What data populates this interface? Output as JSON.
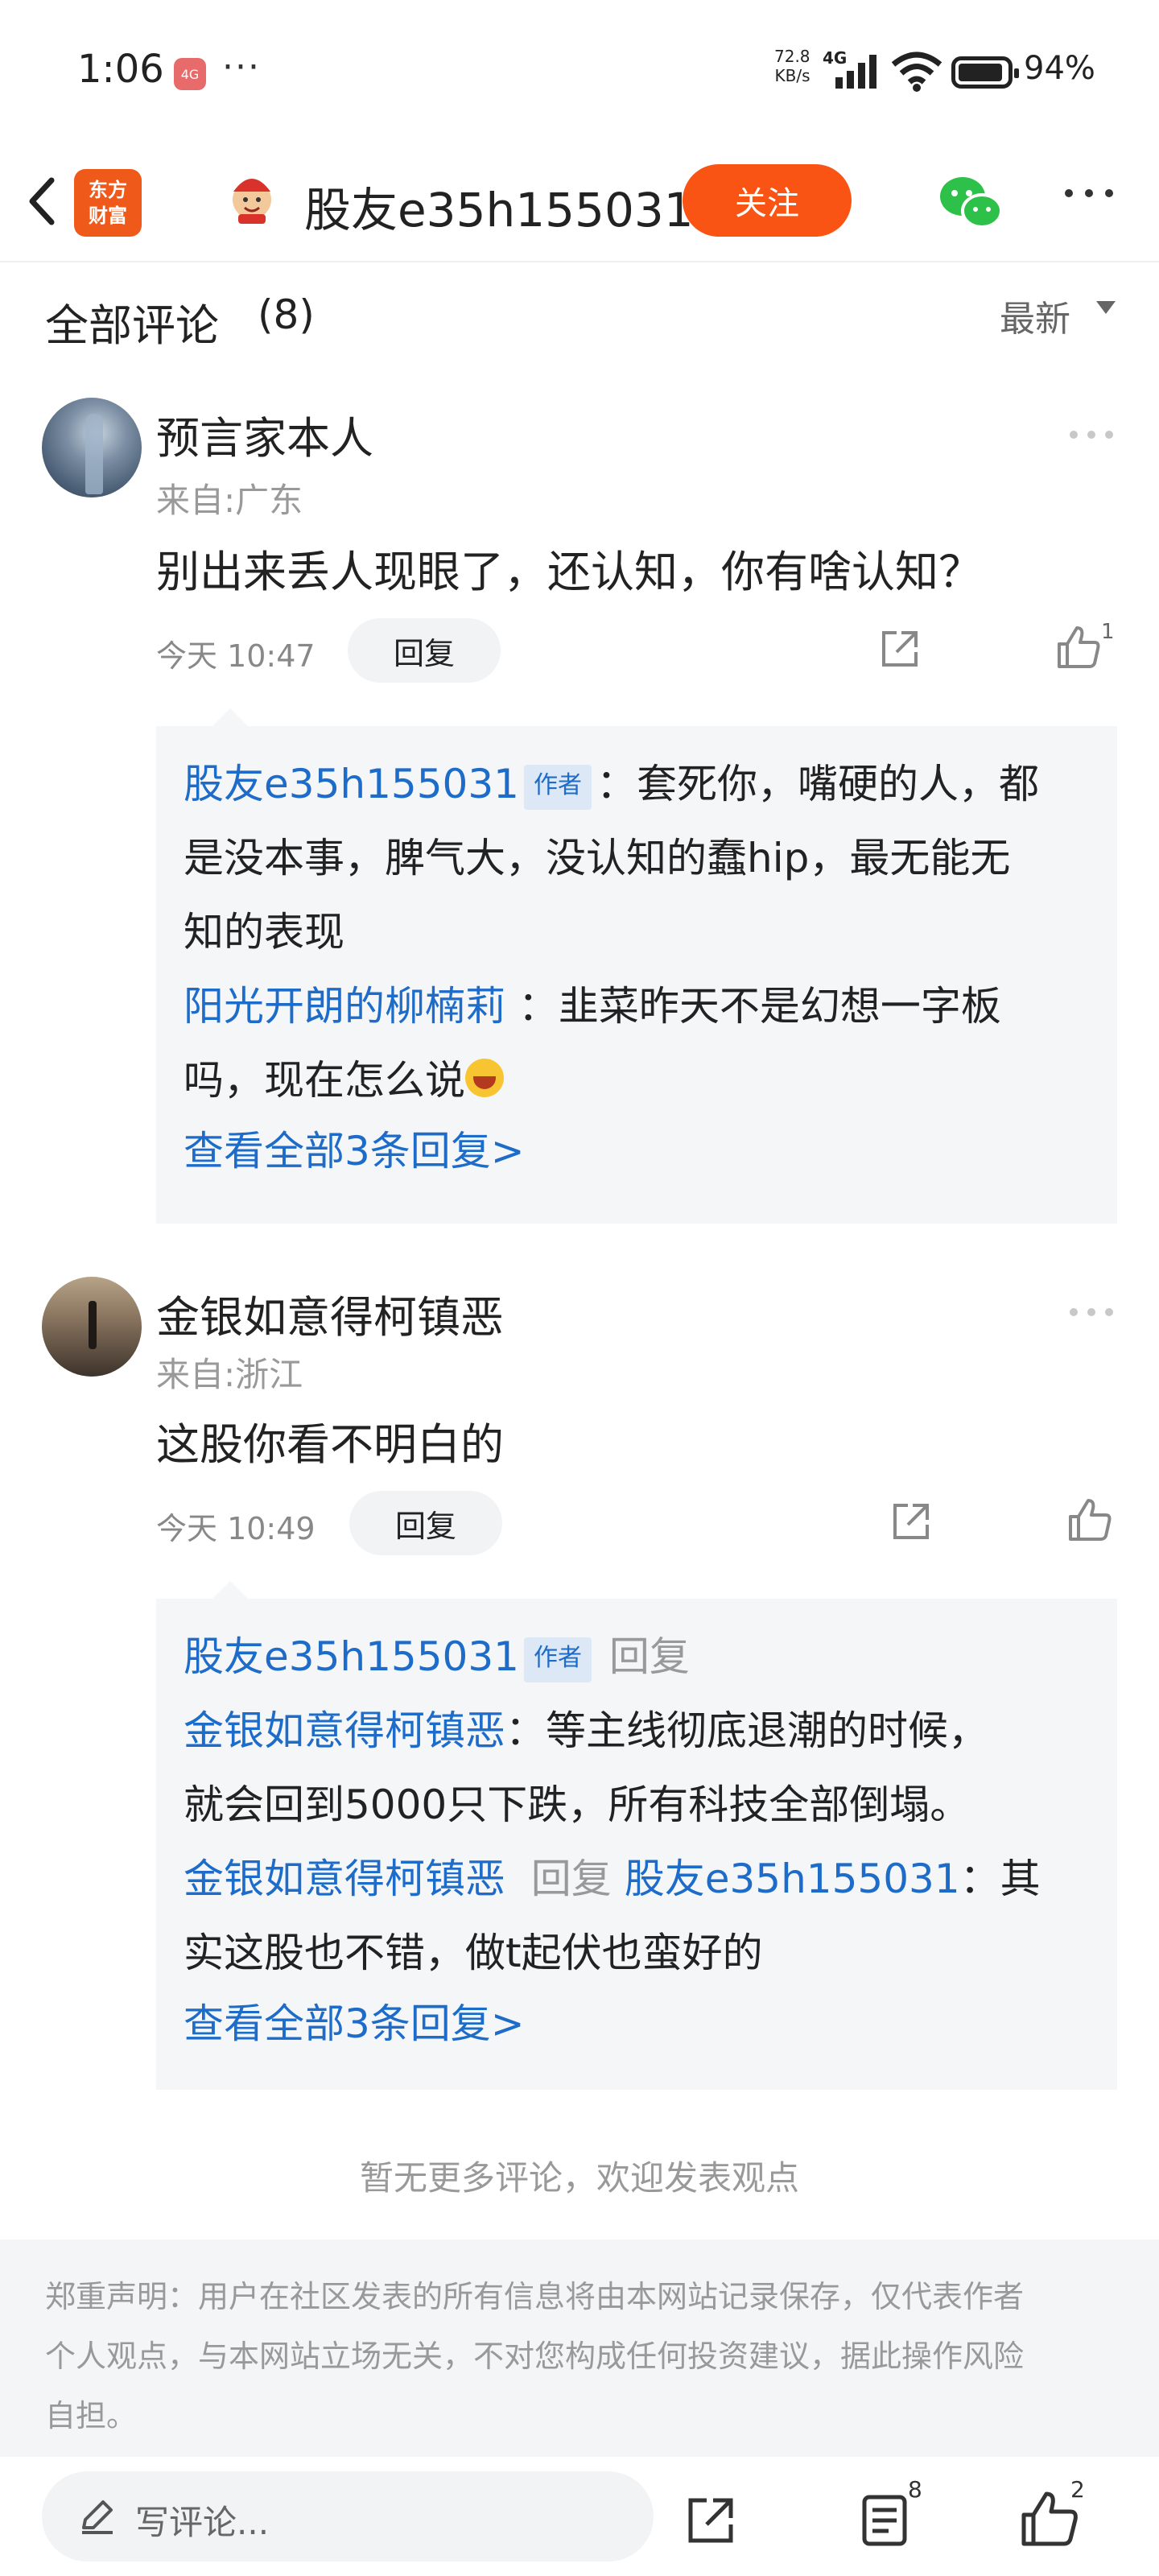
{
  "status_bar": {
    "time": "1:06",
    "app_badge": "4G",
    "more": "···",
    "net_speed_value": "72.8",
    "net_speed_unit": "KB/s",
    "net_type": "4G",
    "battery": "94%"
  },
  "header": {
    "logo_line1": "东方",
    "logo_line2": "财富",
    "title": "股友e35h155031",
    "follow_label": "关注"
  },
  "section": {
    "title": "全部评论",
    "count": "(8)",
    "sort_label": "最新"
  },
  "comments": [
    {
      "username": "预言家本人",
      "location": "来自:广东",
      "text": "别出来丢人现眼了，还认知，你有啥认知？",
      "time": "今天 10:47",
      "reply_label": "回复",
      "likes": "1",
      "replies": {
        "r1_author": "股友e35h155031",
        "r1_badge": "作者",
        "r1_text_line1": "：套死你，嘴硬的人，都",
        "r1_text_line2": "是没本事，脾气大，没认知的蠢hip，最无能无",
        "r1_text_line3": "知的表现",
        "r2_author": "阳光开朗的柳楠莉",
        "r2_text_line1": "：韭菜昨天不是幻想一字板",
        "r2_text_line2": "吗，现在怎么说",
        "view_all": "查看全部3条回复>"
      }
    },
    {
      "username": "金银如意得柯镇恶",
      "location": "来自:浙江",
      "text": "这股你看不明白的",
      "time": "今天 10:49",
      "reply_label": "回复",
      "likes": "",
      "replies": {
        "r1_author": "股友e35h155031",
        "r1_badge": "作者",
        "r1_reply_word": "回复",
        "r1_target": "金银如意得柯镇恶",
        "r1_text_line1": "：等主线彻底退潮的时候，",
        "r1_text_line2": "就会回到5000只下跌，所有科技全部倒塌。",
        "r2_author": "金银如意得柯镇恶",
        "r2_reply_word": "回复",
        "r2_target": "股友e35h155031",
        "r2_text_line1": "：其",
        "r2_text_line2": "实这股也不错，做t起伏也蛮好的",
        "view_all": "查看全部3条回复>"
      }
    }
  ],
  "no_more_text": "暂无更多评论，欢迎发表观点",
  "disclaimer": {
    "line1": "郑重声明：用户在社区发表的所有信息将由本网站记录保存，仅代表作者",
    "line2": "个人观点，与本网站立场无关，不对您构成任何投资建议，据此操作风险",
    "line3": "自担。"
  },
  "bottom_bar": {
    "input_placeholder": "写评论...",
    "comment_count": "8",
    "like_count": "2"
  },
  "colors": {
    "accent_orange": "#fa5414",
    "link_blue": "#1d6cc9"
  }
}
